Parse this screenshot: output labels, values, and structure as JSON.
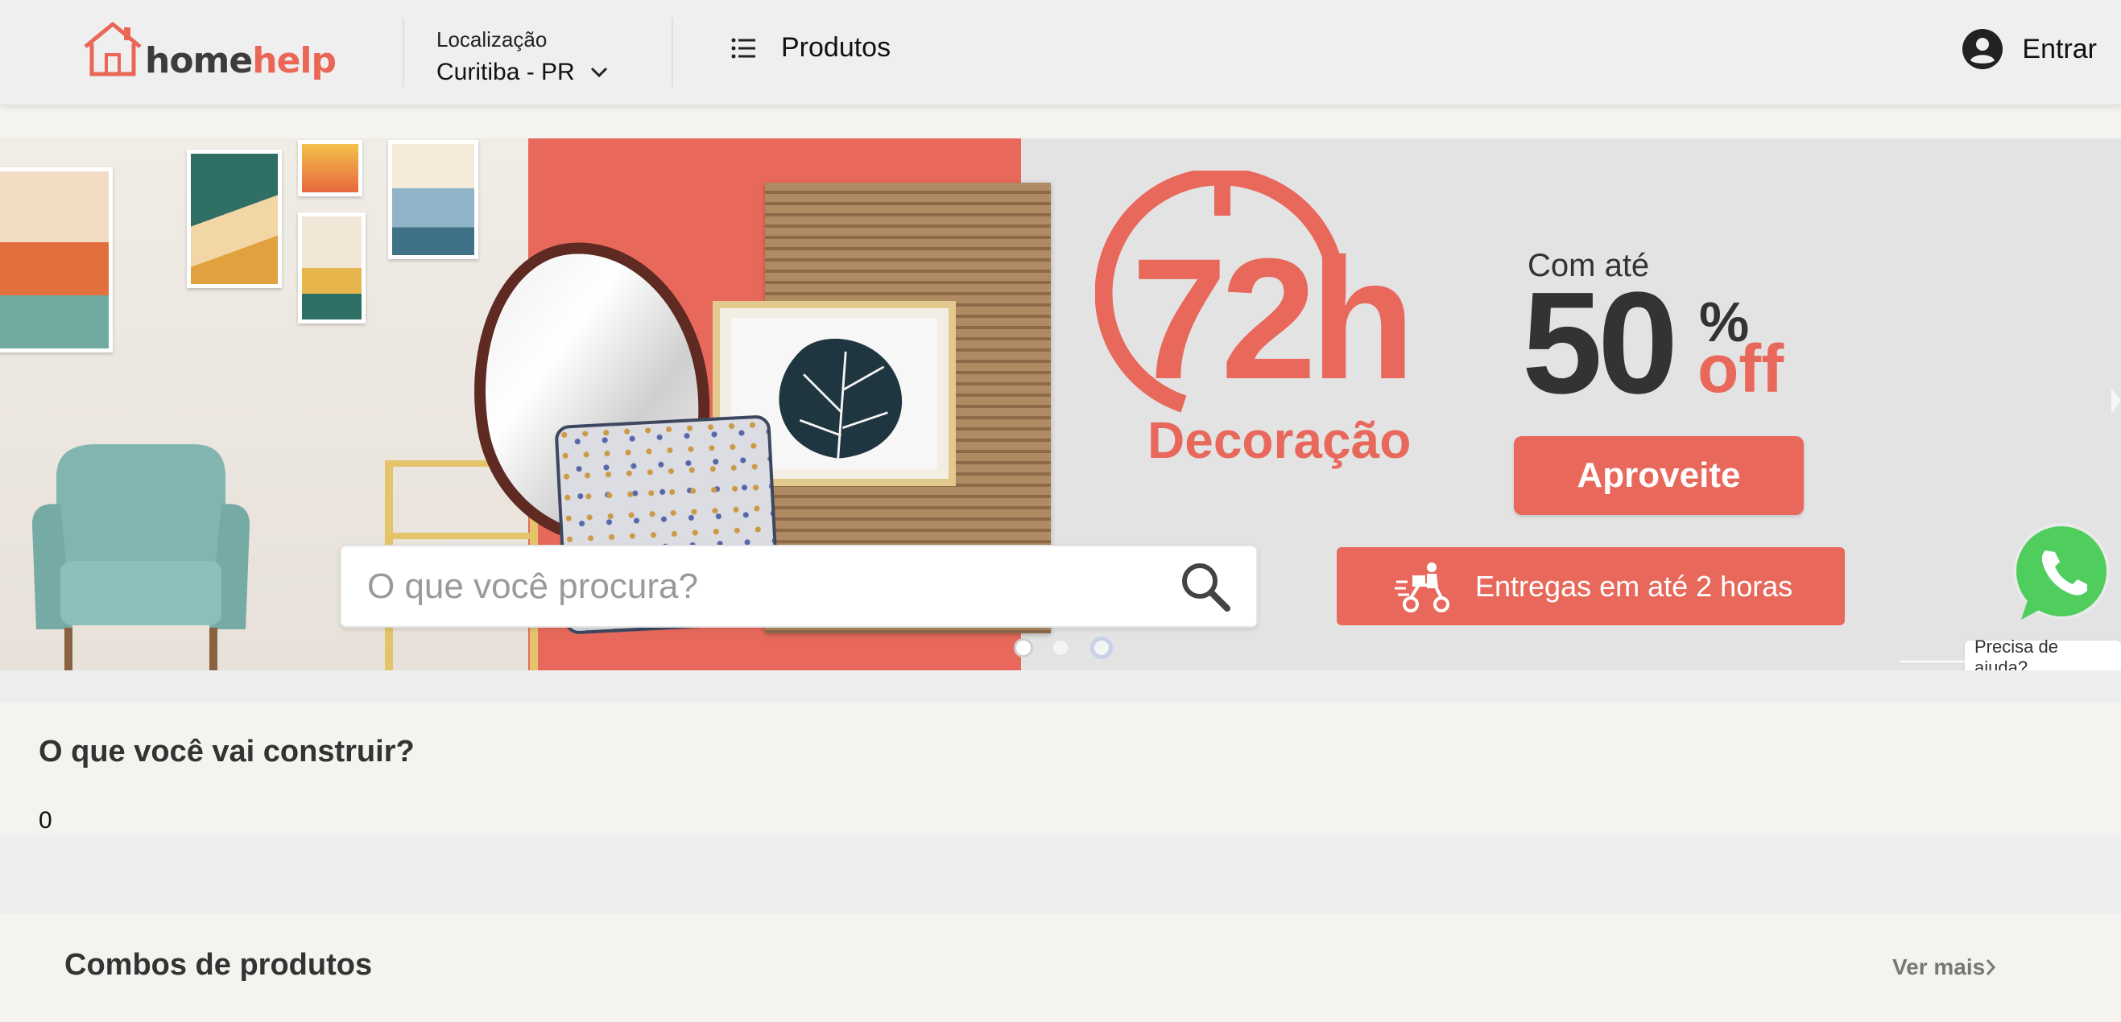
{
  "header": {
    "logo": {
      "home": "home",
      "help": "help"
    },
    "location": {
      "label": "Localização",
      "value": "Curitiba - PR"
    },
    "products_label": "Produtos",
    "login_label": "Entrar"
  },
  "banner": {
    "headline_hours": "72h",
    "headline_category": "Decoração",
    "discount_prefix": "Com até",
    "discount_value": "50",
    "discount_percent": "%",
    "discount_suffix": "off",
    "cta_label": "Aproveite",
    "search_placeholder": "O que você procura?",
    "delivery_label": "Entregas em até 2 horas",
    "carousel": {
      "slide_count": 3,
      "active_index": 0
    }
  },
  "whatsapp": {
    "help_label": "Precisa de ajuda?"
  },
  "section_build": {
    "title": "O que você vai construir?",
    "count": "0"
  },
  "section_combos": {
    "title": "Combos de produtos",
    "see_more_label": "Ver mais"
  },
  "colors": {
    "brand": "#ea6757",
    "dark_text": "#333333",
    "whatsapp": "#4fce5d",
    "header_bg": "#efefef"
  },
  "icons": [
    "house-logo-icon",
    "chevron-down-icon",
    "list-icon",
    "user-circle-icon",
    "search-icon",
    "delivery-moto-icon",
    "whatsapp-icon",
    "chevron-right-icon"
  ]
}
